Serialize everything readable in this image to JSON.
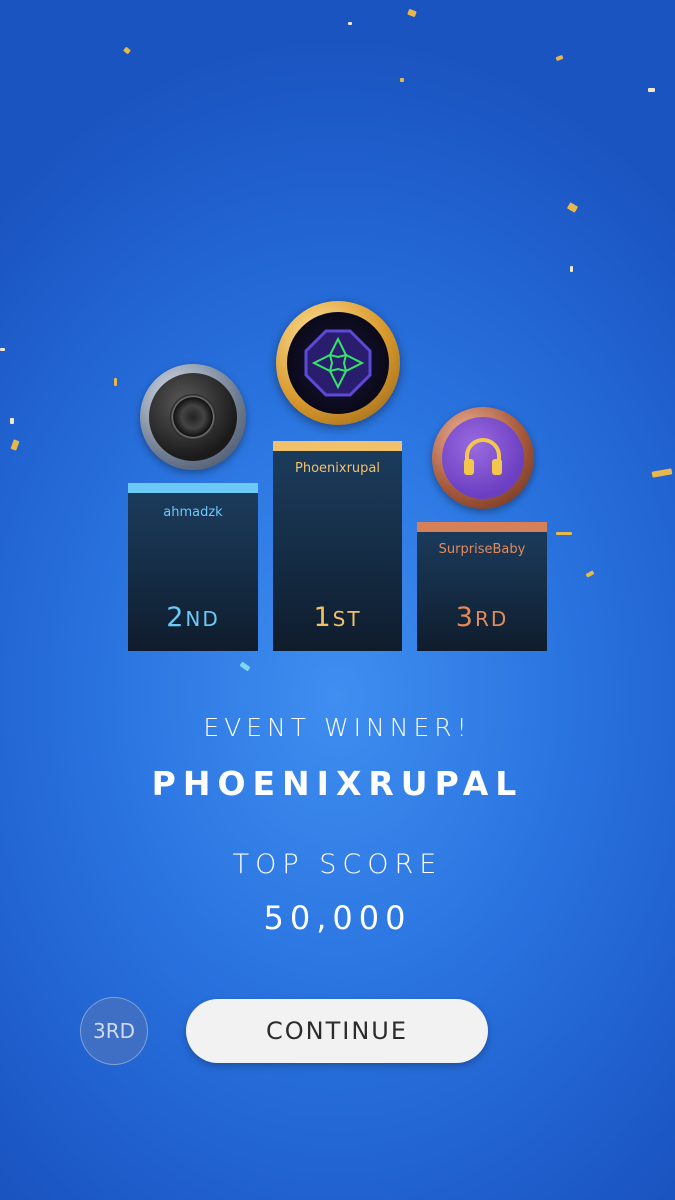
{
  "podium": {
    "second": {
      "name": "ahmadzk",
      "rank_num": "2",
      "rank_suffix": "ND",
      "icon": "speaker-icon",
      "color": "#6cc8f5"
    },
    "first": {
      "name": "Phoenixrupal",
      "rank_num": "1",
      "rank_suffix": "ST",
      "icon": "octagon-gem-icon",
      "color": "#f1c06a"
    },
    "third": {
      "name": "SurpriseBaby",
      "rank_num": "3",
      "rank_suffix": "RD",
      "icon": "headphones-icon",
      "color": "#e28a5a"
    }
  },
  "result": {
    "event_label": "EVENT WINNER!",
    "winner_name": "PHOENIXRUPAL",
    "score_label": "TOP SCORE",
    "score_value": "50,000"
  },
  "footer": {
    "rank_chip": "3RD",
    "continue_label": "CONTINUE"
  }
}
